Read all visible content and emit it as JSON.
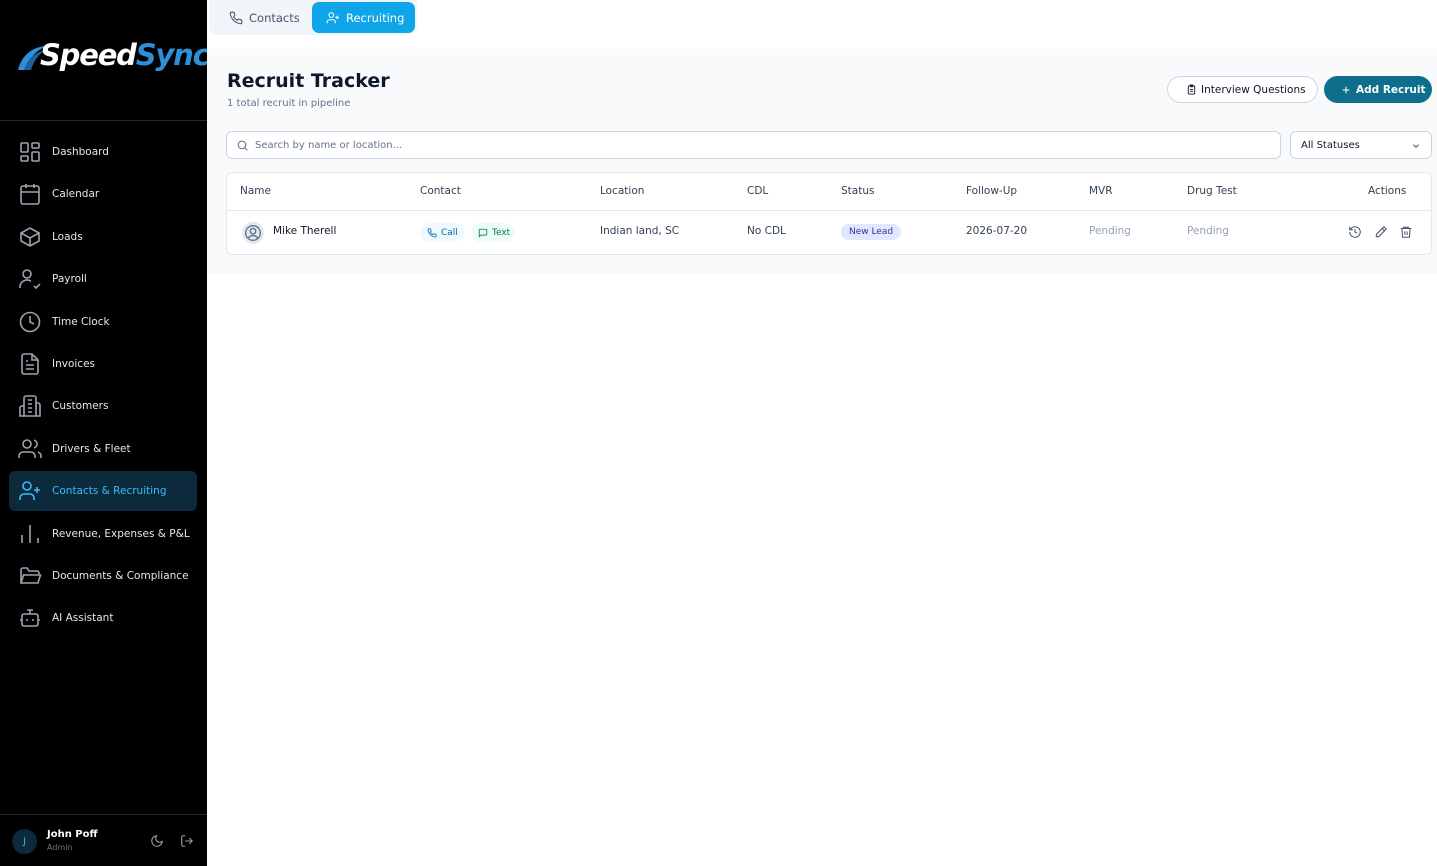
{
  "brand": {
    "name_part1": "Speed",
    "name_part2": "Sync",
    "accent": "#2f8fd6"
  },
  "sidebar": {
    "items": [
      {
        "label": "Dashboard",
        "icon": "dashboard-icon"
      },
      {
        "label": "Calendar",
        "icon": "calendar-icon"
      },
      {
        "label": "Loads",
        "icon": "box-icon"
      },
      {
        "label": "Payroll",
        "icon": "user-check-icon"
      },
      {
        "label": "Time Clock",
        "icon": "clock-icon"
      },
      {
        "label": "Invoices",
        "icon": "file-text-icon"
      },
      {
        "label": "Customers",
        "icon": "building-icon"
      },
      {
        "label": "Drivers & Fleet",
        "icon": "users-icon"
      },
      {
        "label": "Contacts & Recruiting",
        "icon": "user-plus-icon",
        "active": true
      },
      {
        "label": "Revenue, Expenses & P&L",
        "icon": "bar-chart-icon"
      },
      {
        "label": "Documents & Compliance",
        "icon": "folder-icon"
      },
      {
        "label": "AI Assistant",
        "icon": "bot-icon"
      }
    ],
    "user": {
      "initial": "J",
      "name": "John Poff",
      "role": "Admin"
    }
  },
  "tabs": {
    "contacts": "Contacts",
    "recruiting": "Recruiting",
    "active": "recruiting"
  },
  "page": {
    "title": "Recruit Tracker",
    "subtitle": "1 total recruit in pipeline",
    "interview_button": "Interview Questions",
    "add_button": "Add Recruit"
  },
  "search": {
    "placeholder": "Search by name or location...",
    "value": ""
  },
  "filter": {
    "selected": "All Statuses"
  },
  "table": {
    "columns": [
      "Name",
      "Contact",
      "Location",
      "CDL",
      "Status",
      "Follow-Up",
      "MVR",
      "Drug Test",
      "Actions"
    ],
    "rows": [
      {
        "name": "Mike Therell",
        "call": "Call",
        "text": "Text",
        "location": "Indian land, SC",
        "cdl": "No CDL",
        "status": "New Lead",
        "follow_up": "2026-07-20",
        "mvr": "Pending",
        "drug_test": "Pending"
      }
    ]
  },
  "colors": {
    "primary": "#0e6e8c",
    "tab_active": "#0ea5e9",
    "sidebar_bg": "#000000",
    "active_nav": "#38bdf8"
  }
}
